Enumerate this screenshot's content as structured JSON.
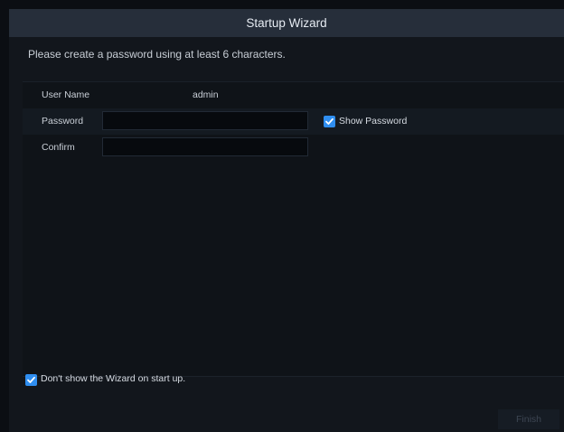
{
  "wizard": {
    "title": "Startup Wizard",
    "instruction": "Please create a password using at least 6 characters.",
    "fields": {
      "user_name_label": "User Name",
      "user_name_value": "admin",
      "password_label": "Password",
      "password_value": "",
      "confirm_label": "Confirm",
      "confirm_value": ""
    },
    "show_password": {
      "label": "Show Password",
      "checked": true
    },
    "dont_show_wizard": {
      "label": "Don't show the Wizard on start up.",
      "checked": true
    },
    "finish_label": "Finish"
  },
  "colors": {
    "accent": "#2f8ef0",
    "titlebar": "#262e3a",
    "background": "#12161c"
  }
}
